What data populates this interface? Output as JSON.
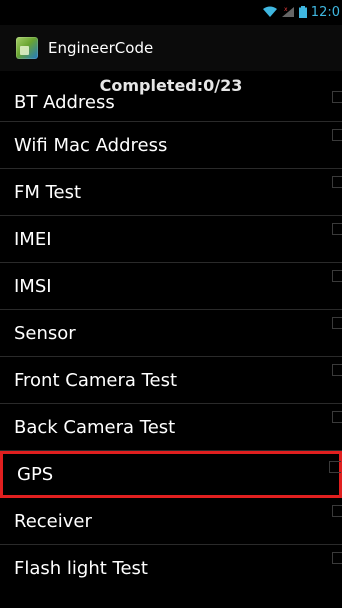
{
  "status_bar": {
    "time": "12:0"
  },
  "app_bar": {
    "title": "EngineerCode"
  },
  "header": {
    "completed": "Completed:0/23"
  },
  "items": [
    {
      "label": "BT Address"
    },
    {
      "label": "Wifi Mac Address"
    },
    {
      "label": "FM Test"
    },
    {
      "label": "IMEI"
    },
    {
      "label": "IMSI"
    },
    {
      "label": "Sensor"
    },
    {
      "label": "Front Camera Test"
    },
    {
      "label": "Back Camera Test"
    },
    {
      "label": "GPS"
    },
    {
      "label": "Receiver"
    },
    {
      "label": "Flash light Test"
    }
  ],
  "colors": {
    "selected_outline": "#e01f1f",
    "status_accent": "#3fb7e0"
  }
}
